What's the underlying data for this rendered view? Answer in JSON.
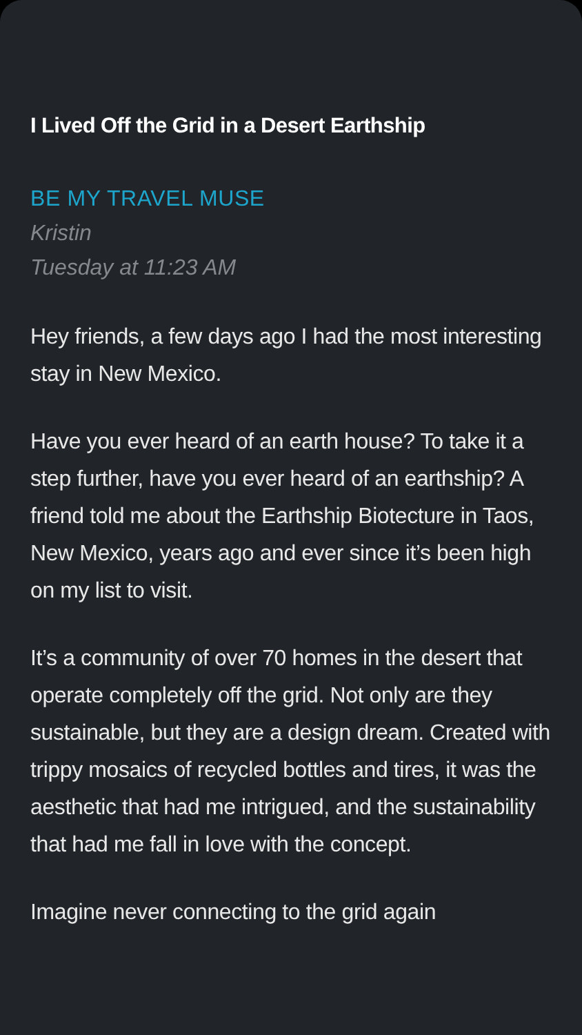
{
  "article": {
    "title": "I Lived Off the Grid in a Desert Earthship",
    "source": "BE MY TRAVEL MUSE",
    "author": "Kristin",
    "date": "Tuesday at 11:23 AM",
    "paragraphs": [
      "Hey friends, a few days ago I had the most interesting stay in New Mexico.",
      "Have you ever heard of an earth house? To take it a step further, have you ever heard of an earthship? A friend told me about the Earthship Biotecture in Taos, New Mexico, years ago and ever since it’s been high on my list to visit.",
      "It’s a community of over 70 homes in the desert that operate completely off the grid. Not only are they sustainable, but they are a design dream. Created with trippy mosaics of recycled bottles and tires, it was the aesthetic that had me intrigued, and the sustainability that had me fall in love with the concept.",
      "Imagine never connecting to the grid again"
    ]
  }
}
